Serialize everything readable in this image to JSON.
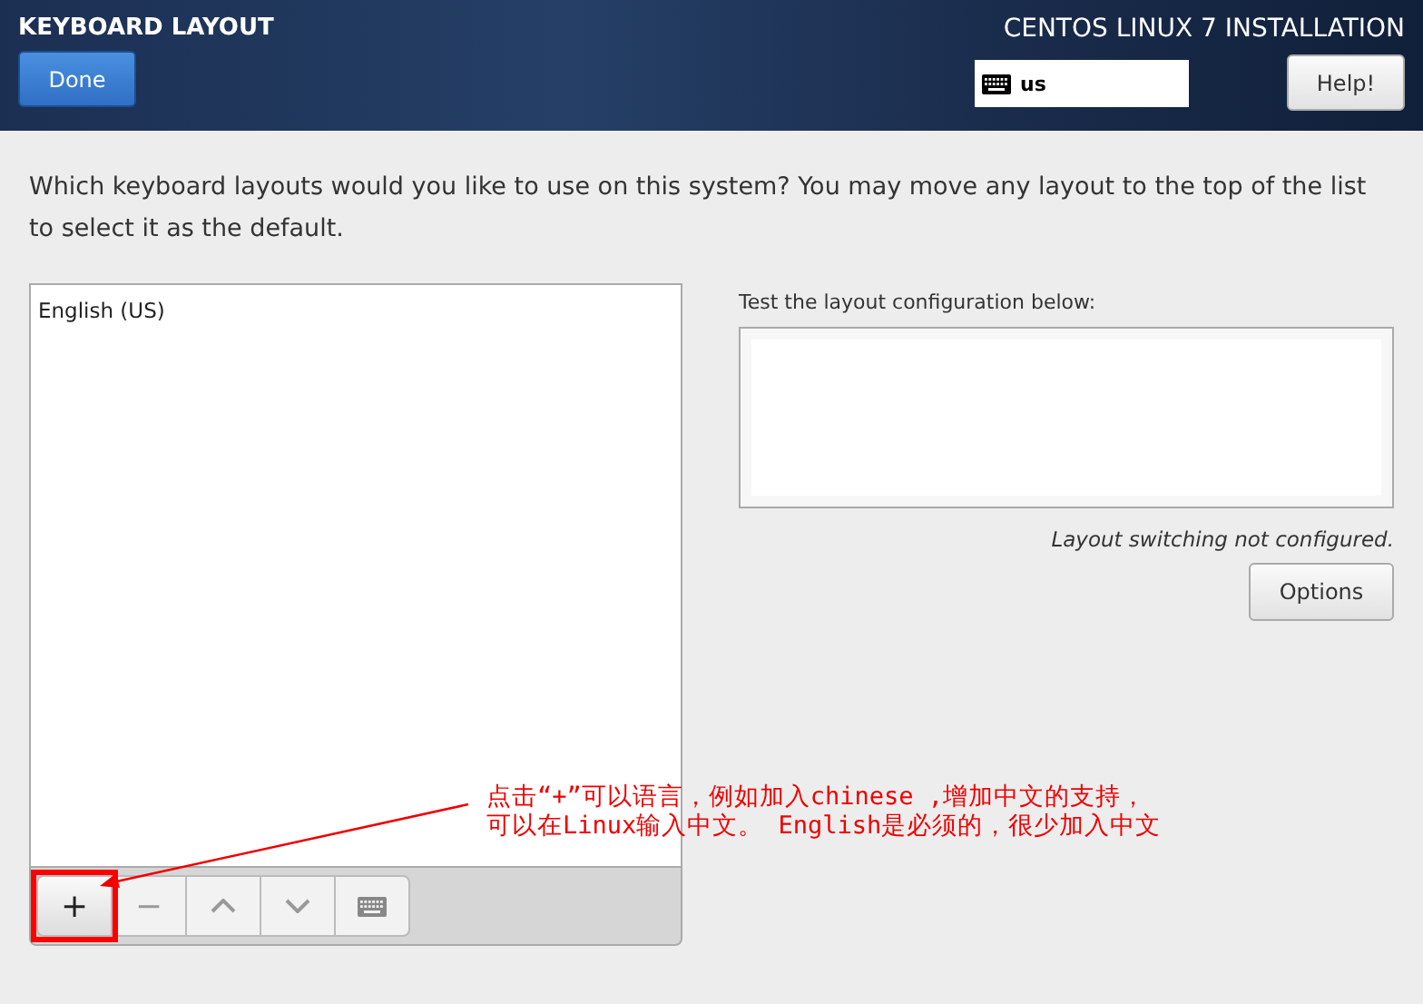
{
  "header": {
    "title": "KEYBOARD LAYOUT",
    "done_button": "Done",
    "product": "CENTOS LINUX 7 INSTALLATION",
    "layout_indicator": "us",
    "help_button": "Help!"
  },
  "question": "Which keyboard layouts would you like to use on this system?  You may move any layout to the top of the list to select it as the default.",
  "layouts": [
    {
      "name": "English (US)",
      "selected": false
    }
  ],
  "toolbar": [
    {
      "kind": "add",
      "label": "+",
      "highlighted": true
    },
    {
      "kind": "remove",
      "label": "−",
      "highlighted": false
    },
    {
      "kind": "up",
      "highlighted": false
    },
    {
      "kind": "down",
      "highlighted": false
    },
    {
      "kind": "preview",
      "highlighted": false
    }
  ],
  "test": {
    "label": "Test the layout configuration below:",
    "note": "Layout switching not configured.",
    "options_button": "Options"
  },
  "annotation": {
    "lines": [
      "点击“+”可以语言，例如加入chinese ,增加中文的支持，",
      "可以在Linux输入中文。 English是必须的，很少加入中文"
    ]
  }
}
